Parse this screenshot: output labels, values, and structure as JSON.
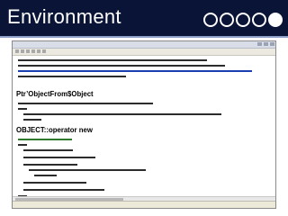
{
  "slide": {
    "title": "Environment",
    "nav_dots": [
      "empty",
      "empty",
      "empty",
      "empty",
      "filled"
    ]
  },
  "editor": {
    "window_title": "",
    "status_text": "",
    "sections": [
      {
        "heading": "Ptr’ObjectFrom$Object",
        "kind": "heading"
      },
      {
        "heading": "OBJECT::operator new",
        "kind": "heading"
      }
    ]
  }
}
